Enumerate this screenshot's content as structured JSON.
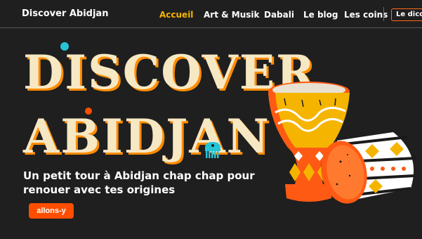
{
  "nav": {
    "brand": "Discover Abidjan",
    "items": [
      {
        "label": "Accueil",
        "active": true
      },
      {
        "label": "Art & Musik",
        "active": false
      },
      {
        "label": "Dabali",
        "active": false
      },
      {
        "label": "Le blog",
        "active": false
      },
      {
        "label": "Les coins",
        "active": false
      }
    ],
    "dico_button": "Le dico"
  },
  "hero": {
    "title_line1": "DISCOVER",
    "title_line2": "ABIDJAN",
    "subtitle": "Un petit tour à Abidjan chap chap pour renouer avec tes origines",
    "cta": "allons-y"
  },
  "colors": {
    "background": "#1f1f1f",
    "accent_orange": "#ff4e00",
    "accent_yellow": "#f5b400",
    "accent_teal": "#27c4d8"
  },
  "icons": [
    "comb-icon",
    "drums-illustration"
  ]
}
